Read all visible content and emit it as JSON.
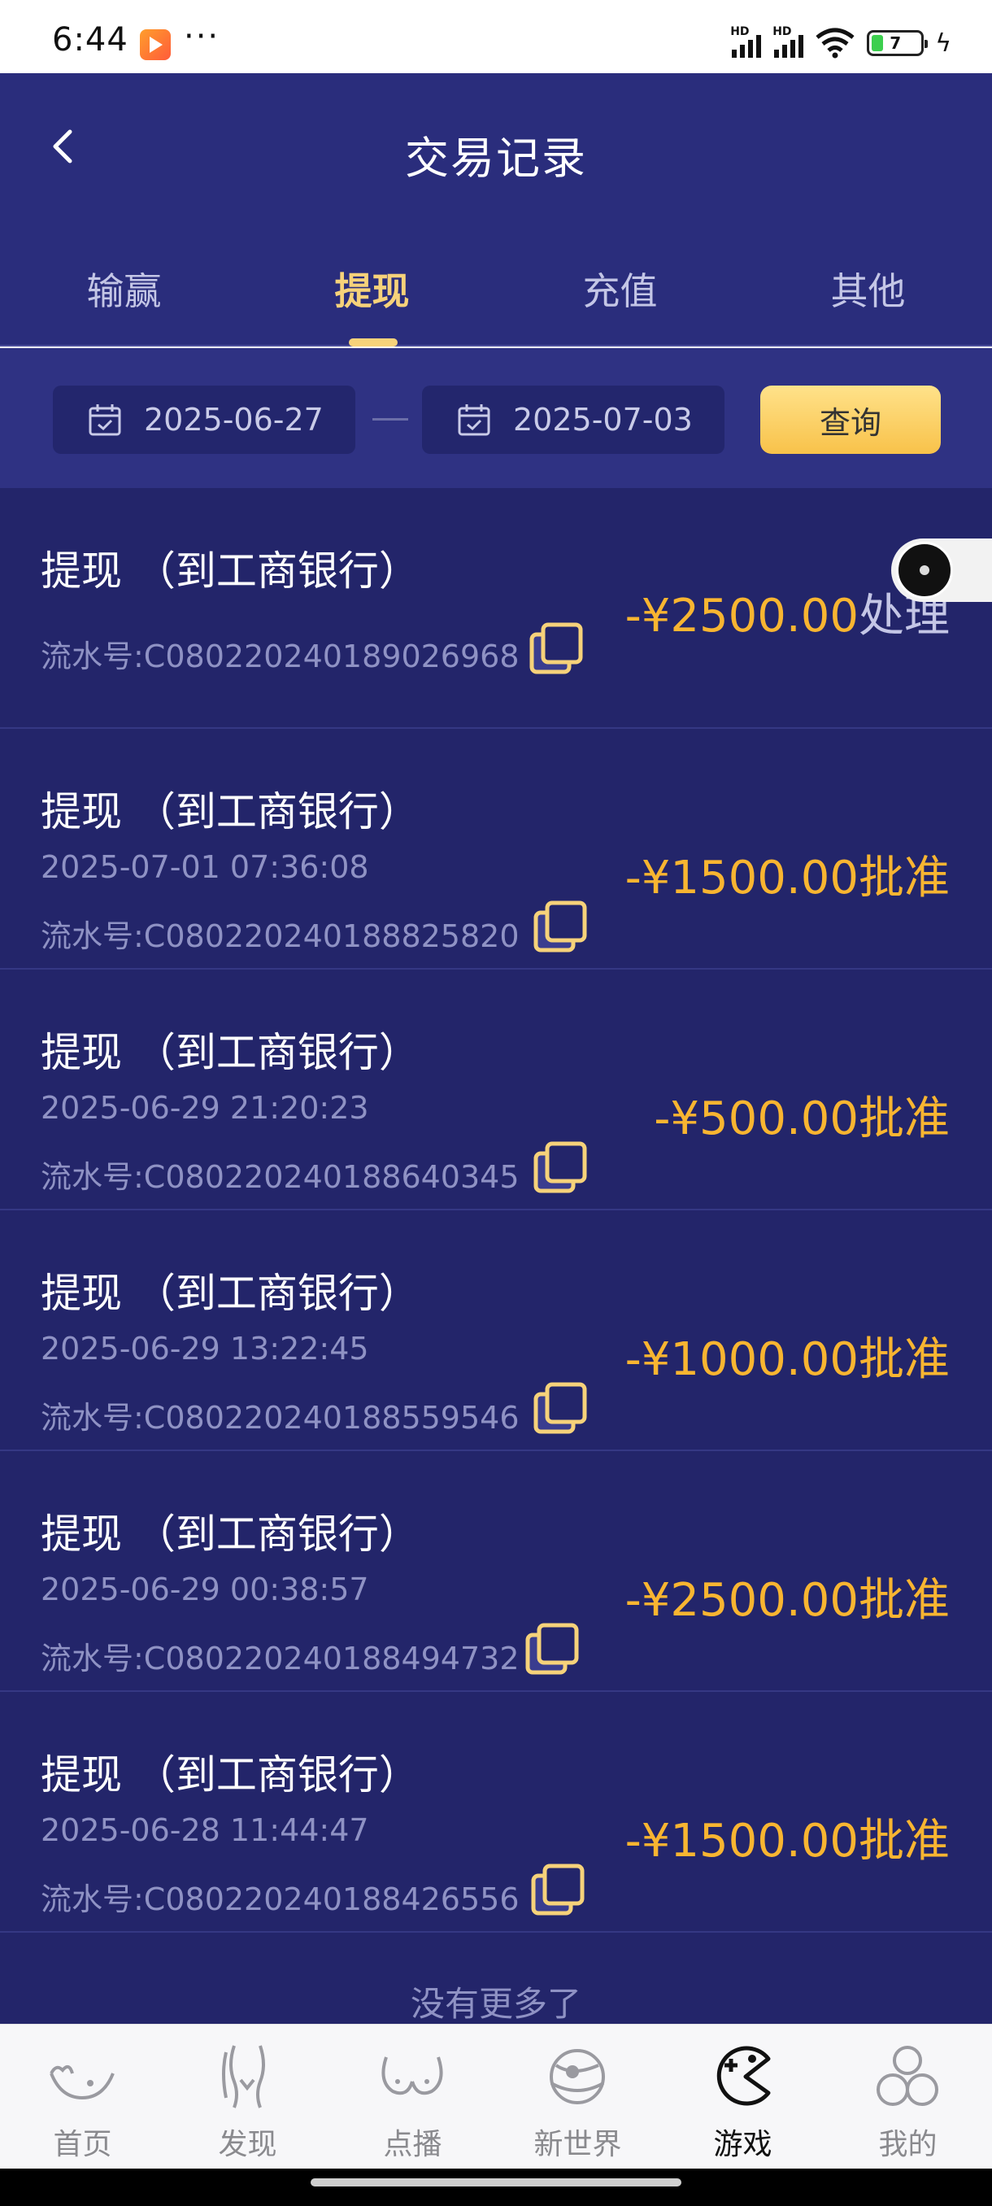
{
  "status_bar": {
    "time": "6:44",
    "dots": "···",
    "battery": "7",
    "signal_label": "HD"
  },
  "header": {
    "title": "交易记录"
  },
  "tabs": [
    {
      "label": "输赢",
      "active": false
    },
    {
      "label": "提现",
      "active": true
    },
    {
      "label": "充值",
      "active": false
    },
    {
      "label": "其他",
      "active": false
    }
  ],
  "filter": {
    "start_date": "2025-06-27",
    "end_date": "2025-07-03",
    "query_label": "查询"
  },
  "records": [
    {
      "title": "提现 （到工商银行）",
      "time": "",
      "serial": "流水号:C080220240189026968",
      "amount": "-¥2500.00",
      "status": "处理"
    },
    {
      "title": "提现 （到工商银行）",
      "time": "2025-07-01 07:36:08",
      "serial": "流水号:C080220240188825820",
      "amount": "-¥1500.00",
      "status": "批准"
    },
    {
      "title": "提现 （到工商银行）",
      "time": "2025-06-29 21:20:23",
      "serial": "流水号:C080220240188640345",
      "amount": "-¥500.00",
      "status": "批准"
    },
    {
      "title": "提现 （到工商银行）",
      "time": "2025-06-29 13:22:45",
      "serial": "流水号:C080220240188559546",
      "amount": "-¥1000.00",
      "status": "批准"
    },
    {
      "title": "提现 （到工商银行）",
      "time": "2025-06-29 00:38:57",
      "serial": "流水号:C080220240188494732",
      "amount": "-¥2500.00",
      "status": "批准"
    },
    {
      "title": "提现 （到工商银行）",
      "time": "2025-06-28 11:44:47",
      "serial": "流水号:C080220240188426556",
      "amount": "-¥1500.00",
      "status": "批准"
    }
  ],
  "no_more": "没有更多了",
  "bottom_nav": [
    {
      "label": "首页",
      "icon": "home-icon",
      "active": false
    },
    {
      "label": "发现",
      "icon": "discover-icon",
      "active": false
    },
    {
      "label": "点播",
      "icon": "vod-icon",
      "active": false
    },
    {
      "label": "新世界",
      "icon": "new-world-icon",
      "active": false
    },
    {
      "label": "游戏",
      "icon": "game-icon",
      "active": true
    },
    {
      "label": "我的",
      "icon": "profile-icon",
      "active": false
    }
  ],
  "colors": {
    "header_bg": "#2a2d7c",
    "list_bg": "#23256a",
    "accent_gold": "#f6d27a",
    "amount": "#f8b531",
    "query_button": "#f8c24a"
  }
}
